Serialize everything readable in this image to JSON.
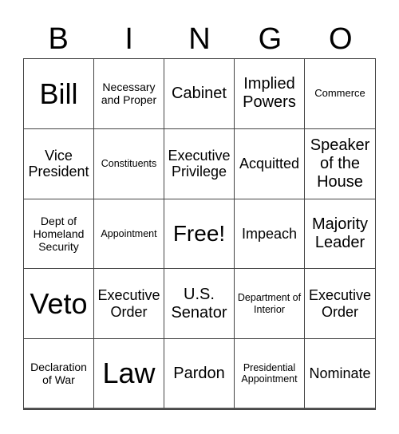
{
  "header": {
    "letters": [
      "B",
      "I",
      "N",
      "G",
      "O"
    ]
  },
  "board": {
    "rows": [
      [
        "Bill",
        "Necessary and Proper",
        "Cabinet",
        "Implied Powers",
        "Commerce"
      ],
      [
        "Vice President",
        "Constituents",
        "Executive Privilege",
        "Acquitted",
        "Speaker of the House"
      ],
      [
        "Dept of Homeland Security",
        "Appointment",
        "Free!",
        "Impeach",
        "Majority Leader"
      ],
      [
        "Veto",
        "Executive Order",
        "U.S. Senator",
        "Department of Interior",
        "Executive Order"
      ],
      [
        "Declaration of War",
        "Law",
        "Pardon",
        "Presidential Appointment",
        "Nominate"
      ]
    ]
  }
}
